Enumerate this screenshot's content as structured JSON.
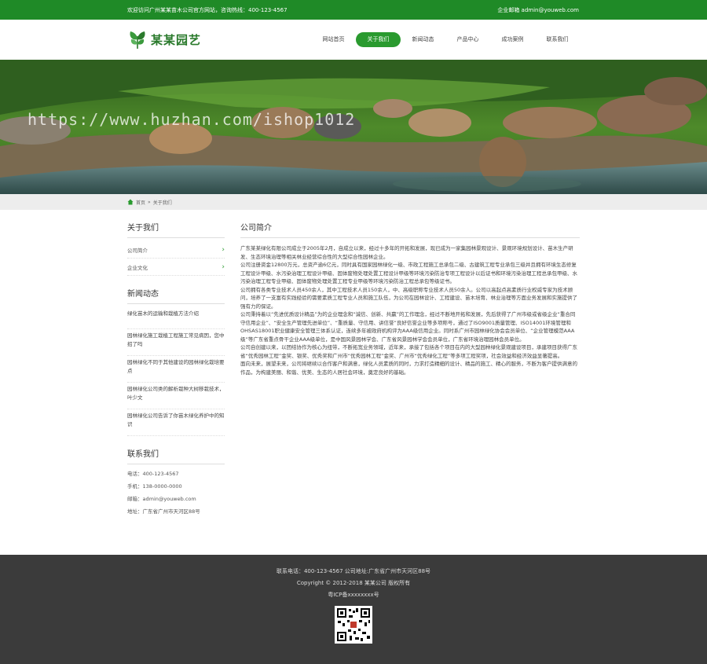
{
  "topbar": {
    "welcome": "欢迎访问广州某某苗木公司官方网站，咨询热线：400-123-4567",
    "email": "企业邮箱 admin@youweb.com"
  },
  "header": {
    "logo_text": "某某园艺",
    "nav": [
      {
        "label": "网站首页"
      },
      {
        "label": "关于我们"
      },
      {
        "label": "新闻动态"
      },
      {
        "label": "产品中心"
      },
      {
        "label": "成功案例"
      },
      {
        "label": "联系我们"
      }
    ]
  },
  "banner": {
    "watermark": "https://www.huzhan.com/ishop1012"
  },
  "breadcrumb": {
    "home": "首页",
    "sep": "»",
    "current": "关于我们"
  },
  "sidebar": {
    "about_title": "关于我们",
    "about_links": [
      {
        "label": "公司简介"
      },
      {
        "label": "企业文化"
      }
    ],
    "news_title": "新闻动态",
    "news": [
      {
        "title": "绿化苗木的运输和栽植方法介绍"
      },
      {
        "title": "园林绿化施工栽植工程施工常见病因，您中招了吗"
      },
      {
        "title": "园林绿化不同于其他建设的园林绿化栽培要点"
      },
      {
        "title": "园林绿化公司类的解析栽种大树移栽技术，叶少文"
      },
      {
        "title": "园林绿化公司告诉了你苗木绿化养护中的知识"
      }
    ],
    "contact_title": "联系我们",
    "contact": [
      {
        "text": "电话：400-123-4567"
      },
      {
        "text": "手机：138-0000-0000"
      },
      {
        "text": "邮箱：admin@youweb.com"
      },
      {
        "text": "地址：广东省广州市天河区88号"
      }
    ]
  },
  "content": {
    "title": "公司简介",
    "paragraphs": [
      "广东某某绿化有限公司成立于2005年2月，自成立以来，经过十多年的开拓和发展，现已成为一家集园林景观设计、景观环境规划设计、苗木生产研发、生态环境治理等相关林业经营综合性的大型综合性园林企业。",
      "公司注册资金12800万元，总资产逾6亿元，同时具有国家园林绿化一级、市政工程施工总承包二级、古建筑工程专业承包三级并且拥有环境生态修复工程设计甲级、水污染治理工程设计甲级、固体废物处理处置工程设计甲级等环境污染防治专项工程设计以后证书和环境污染治理工程总承包甲级、水污染治理工程专业甲级、固体废物处理处置工程专业甲级等环境污染防治工程总承包等级证书。",
      "公司拥有各类专业技术人员450余人，其中工程技术人员150余人，中、高级职称专业技术人员50余人。公司以高起点高素质行业权威专家为技术顾问，培养了一支富有实践经验的需要素质工程专业人员和施工队伍，为公司在园林设计、工程建设、苗木培育、林业治理等方面业务发展和实施提供了强有力的保证。",
      "公司秉持着以“先进优质设计精品”为的企业理念和“诚信、创新、共赢”的工作理念，经过不断地开拓和发展，先后获得了广州市级或省级企业“重合同守信用企业”、“安全生产管理先进单位”、“重质量、守信用、讲信誉”良好信誉企业等多项称号，通过了ISO9001质量管理、ISO14001环境管理和OHSAS18001职业健康安全管理三体系认证，连续多年被政府机构评为AAA级信用企业。同时系广州市园林绿化协会会员单位、“企业管理模范AAA级”等广东省重点骨干企业AAA级单位，是中国风景园林学会、广东省风景园林学会会员单位，广东省环境治理园林会员单位。",
      "公司自创建以来，以团结协作为核心为纽带，不断拓宽业务领域，近年来，承接了包括各个项目在内的大型园林绿化景观建设项目，承建项目获得广东省“优秀园林工程”金奖、银奖、优秀奖和广州市“优秀园林工程”金奖、广州市“优秀绿化工程”等多项工程奖项，社会效益和经济效益显著提高。",
      "面向未来，展望未来，公司将继续以合作客户和满意，绿化人员素质的同时，力求打造精细的设计、精品的施工、精心的服务，不断为客户提供满意的作品，为构建美丽、和谐、优美、生态的人居社会环境，奠定良好的基础。"
    ]
  },
  "footer": {
    "line1": "联系电话：400-123-4567 公司地址:广东省广州市天河区88号",
    "line2": "Copyright © 2012-2018 某某公司 版权所有",
    "line3": "粤ICP备xxxxxxxx号"
  },
  "colors": {
    "brand_green": "#1f8a27",
    "nav_active": "#2a9a2f",
    "footer_bg": "#3b3b3b"
  }
}
